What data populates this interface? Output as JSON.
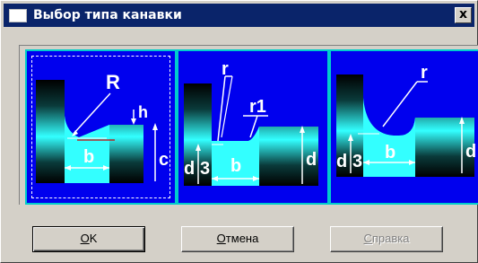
{
  "window": {
    "title": "Выбор типа канавки",
    "close_glyph": "x"
  },
  "options": [
    {
      "labels": {
        "radius": "R",
        "height": "h",
        "width": "b",
        "depth": "c"
      },
      "selected": true
    },
    {
      "labels": {
        "radius": "r",
        "radius2": "r1",
        "width": "b",
        "depth1": "d",
        "digit": "3",
        "depth2": "d"
      }
    },
    {
      "labels": {
        "radius": "r",
        "width": "b",
        "depth1": "d",
        "digit": "3",
        "depth2": "d"
      }
    }
  ],
  "buttons": {
    "ok": {
      "accel": "O",
      "rest": "K"
    },
    "cancel": {
      "accel": "О",
      "rest": "тмена"
    },
    "help": {
      "accel": "С",
      "rest": "правка"
    }
  },
  "colors": {
    "titlebar": "#0a246a",
    "option_bg": "#0000ee",
    "groove_fill": "#33ffff",
    "selection_border": "#00cccc"
  }
}
